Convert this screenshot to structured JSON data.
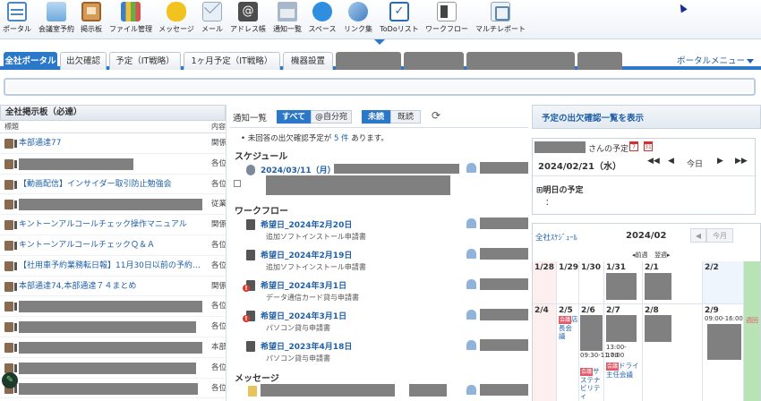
{
  "toolbar": {
    "items": [
      {
        "label": "ポータル",
        "icon": "portal-icon"
      },
      {
        "label": "会議室予約",
        "icon": "meeting-room-icon"
      },
      {
        "label": "掲示板",
        "icon": "bulletin-board-icon"
      },
      {
        "label": "ファイル管理",
        "icon": "file-management-icon"
      },
      {
        "label": "メッセージ",
        "icon": "message-icon"
      },
      {
        "label": "メール",
        "icon": "mail-icon"
      },
      {
        "label": "アドレス帳",
        "icon": "address-book-icon"
      },
      {
        "label": "通知一覧",
        "icon": "notification-list-icon"
      },
      {
        "label": "スペース",
        "icon": "space-icon"
      },
      {
        "label": "リンク集",
        "icon": "link-collection-icon"
      },
      {
        "label": "ToDoリスト",
        "icon": "todo-list-icon"
      },
      {
        "label": "ワークフロー",
        "icon": "workflow-icon"
      },
      {
        "label": "マルチレポート",
        "icon": "multi-report-icon"
      }
    ],
    "address_icon_glyph": "@",
    "todo_icon_glyph": "✓"
  },
  "tabs": [
    {
      "label": "全社ポータル",
      "active": true
    },
    {
      "label": "出欠確認"
    },
    {
      "label": "予定（IT戦略）"
    },
    {
      "label": "1ヶ月予定（IT戦略）"
    },
    {
      "label": "機器設置"
    }
  ],
  "portal_menu": "ポータルメニュー",
  "bulletin": {
    "title": "全社掲示板（必達）",
    "col_title": "標題",
    "col_category": "内容",
    "rows": [
      {
        "title": "本部通達77",
        "category": "関係"
      },
      {
        "title": "",
        "category": "各位"
      },
      {
        "title": "【動画配信】インサイダー取引防止勉強会",
        "category": "各位"
      },
      {
        "title": "",
        "category": "従業"
      },
      {
        "title": "キントーンアルコールチェック操作マニュアル",
        "category": "関係"
      },
      {
        "title": "キントーンアルコールチェックＱ＆Ａ",
        "category": "各位"
      },
      {
        "title": "【社用車予約業務転日報】11月30日以前の予約にお...",
        "category": "各位"
      },
      {
        "title": "本部通達74,本部通達７４まとめ",
        "category": "関係"
      },
      {
        "title": "",
        "category": "各位"
      },
      {
        "title": "",
        "category": "各位"
      },
      {
        "title": "",
        "category": "本部"
      },
      {
        "title": "",
        "category": "各位"
      },
      {
        "title": "",
        "category": "各位"
      },
      {
        "title": "",
        "category": "各位"
      }
    ]
  },
  "notifications": {
    "title": "通知一覧",
    "filter_all": "すべて",
    "filter_mine": "@自分宛",
    "filter_unread": "未読",
    "filter_read": "既読",
    "notice_prefix": "未回答の出欠確認予定が",
    "notice_count": "5 件",
    "notice_suffix": "あります。",
    "schedule_section": "スケジュール",
    "schedule_item": "2024/03/11（月）",
    "workflow_section": "ワークフロー",
    "workflow_items": [
      {
        "title": "希望日_2024年2月20日",
        "sub": "追加ソフトインストール申請書"
      },
      {
        "title": "希望日_2024年2月19日",
        "sub": "追加ソフトインストール申請書"
      },
      {
        "title": "希望日_2024年3月1日",
        "sub": "データ通信カード貸与申請書"
      },
      {
        "title": "希望日_2024年3月1日",
        "sub": "パソコン貸与申請書"
      },
      {
        "title": "希望日_2023年4月18日",
        "sub": "パソコン貸与申請書"
      }
    ],
    "message_section": "メッセージ"
  },
  "schedule": {
    "confirm_link": "予定の出欠確認一覧を表示",
    "user_suffix": "さんの予定",
    "date": "2024/02/21（水）",
    "today": "今日",
    "nav_first": "◀◀",
    "nav_prev": "◀",
    "nav_next": "▶",
    "nav_last": "▶▶",
    "tomorrow_label": "明日の予定",
    "tomorrow_value": "：",
    "cal1_glyph": "7",
    "cal2_glyph": "31"
  },
  "month": {
    "title": "全社ｽｹｼﾞｭｰﾙ",
    "month": "2024/02",
    "prev_btn": "◀",
    "this_btn": "今月",
    "sub_prev": "◂前週",
    "sub_next": "翌週▸",
    "week1": [
      "1/28",
      "1/29",
      "1/30",
      "1/31",
      "2/1",
      "2/2"
    ],
    "week2": [
      "2/4",
      "2/5",
      "2/6",
      "2/7",
      "2/8",
      "2/9"
    ],
    "ev_tenchoukai": "店長会議",
    "ev_tag": "会議",
    "ev_time1": "09:30-11:00",
    "ev_sustain": "サステナビリティ",
    "ev_time2": "13:00-17:00",
    "ev_dora": "ドライ主任会議",
    "ev_time3": "09:00-16:00",
    "today_col_text": "週回"
  },
  "colors": {
    "accent": "#2c78c8",
    "link": "#1f5fa8",
    "redaction": "#808080"
  }
}
